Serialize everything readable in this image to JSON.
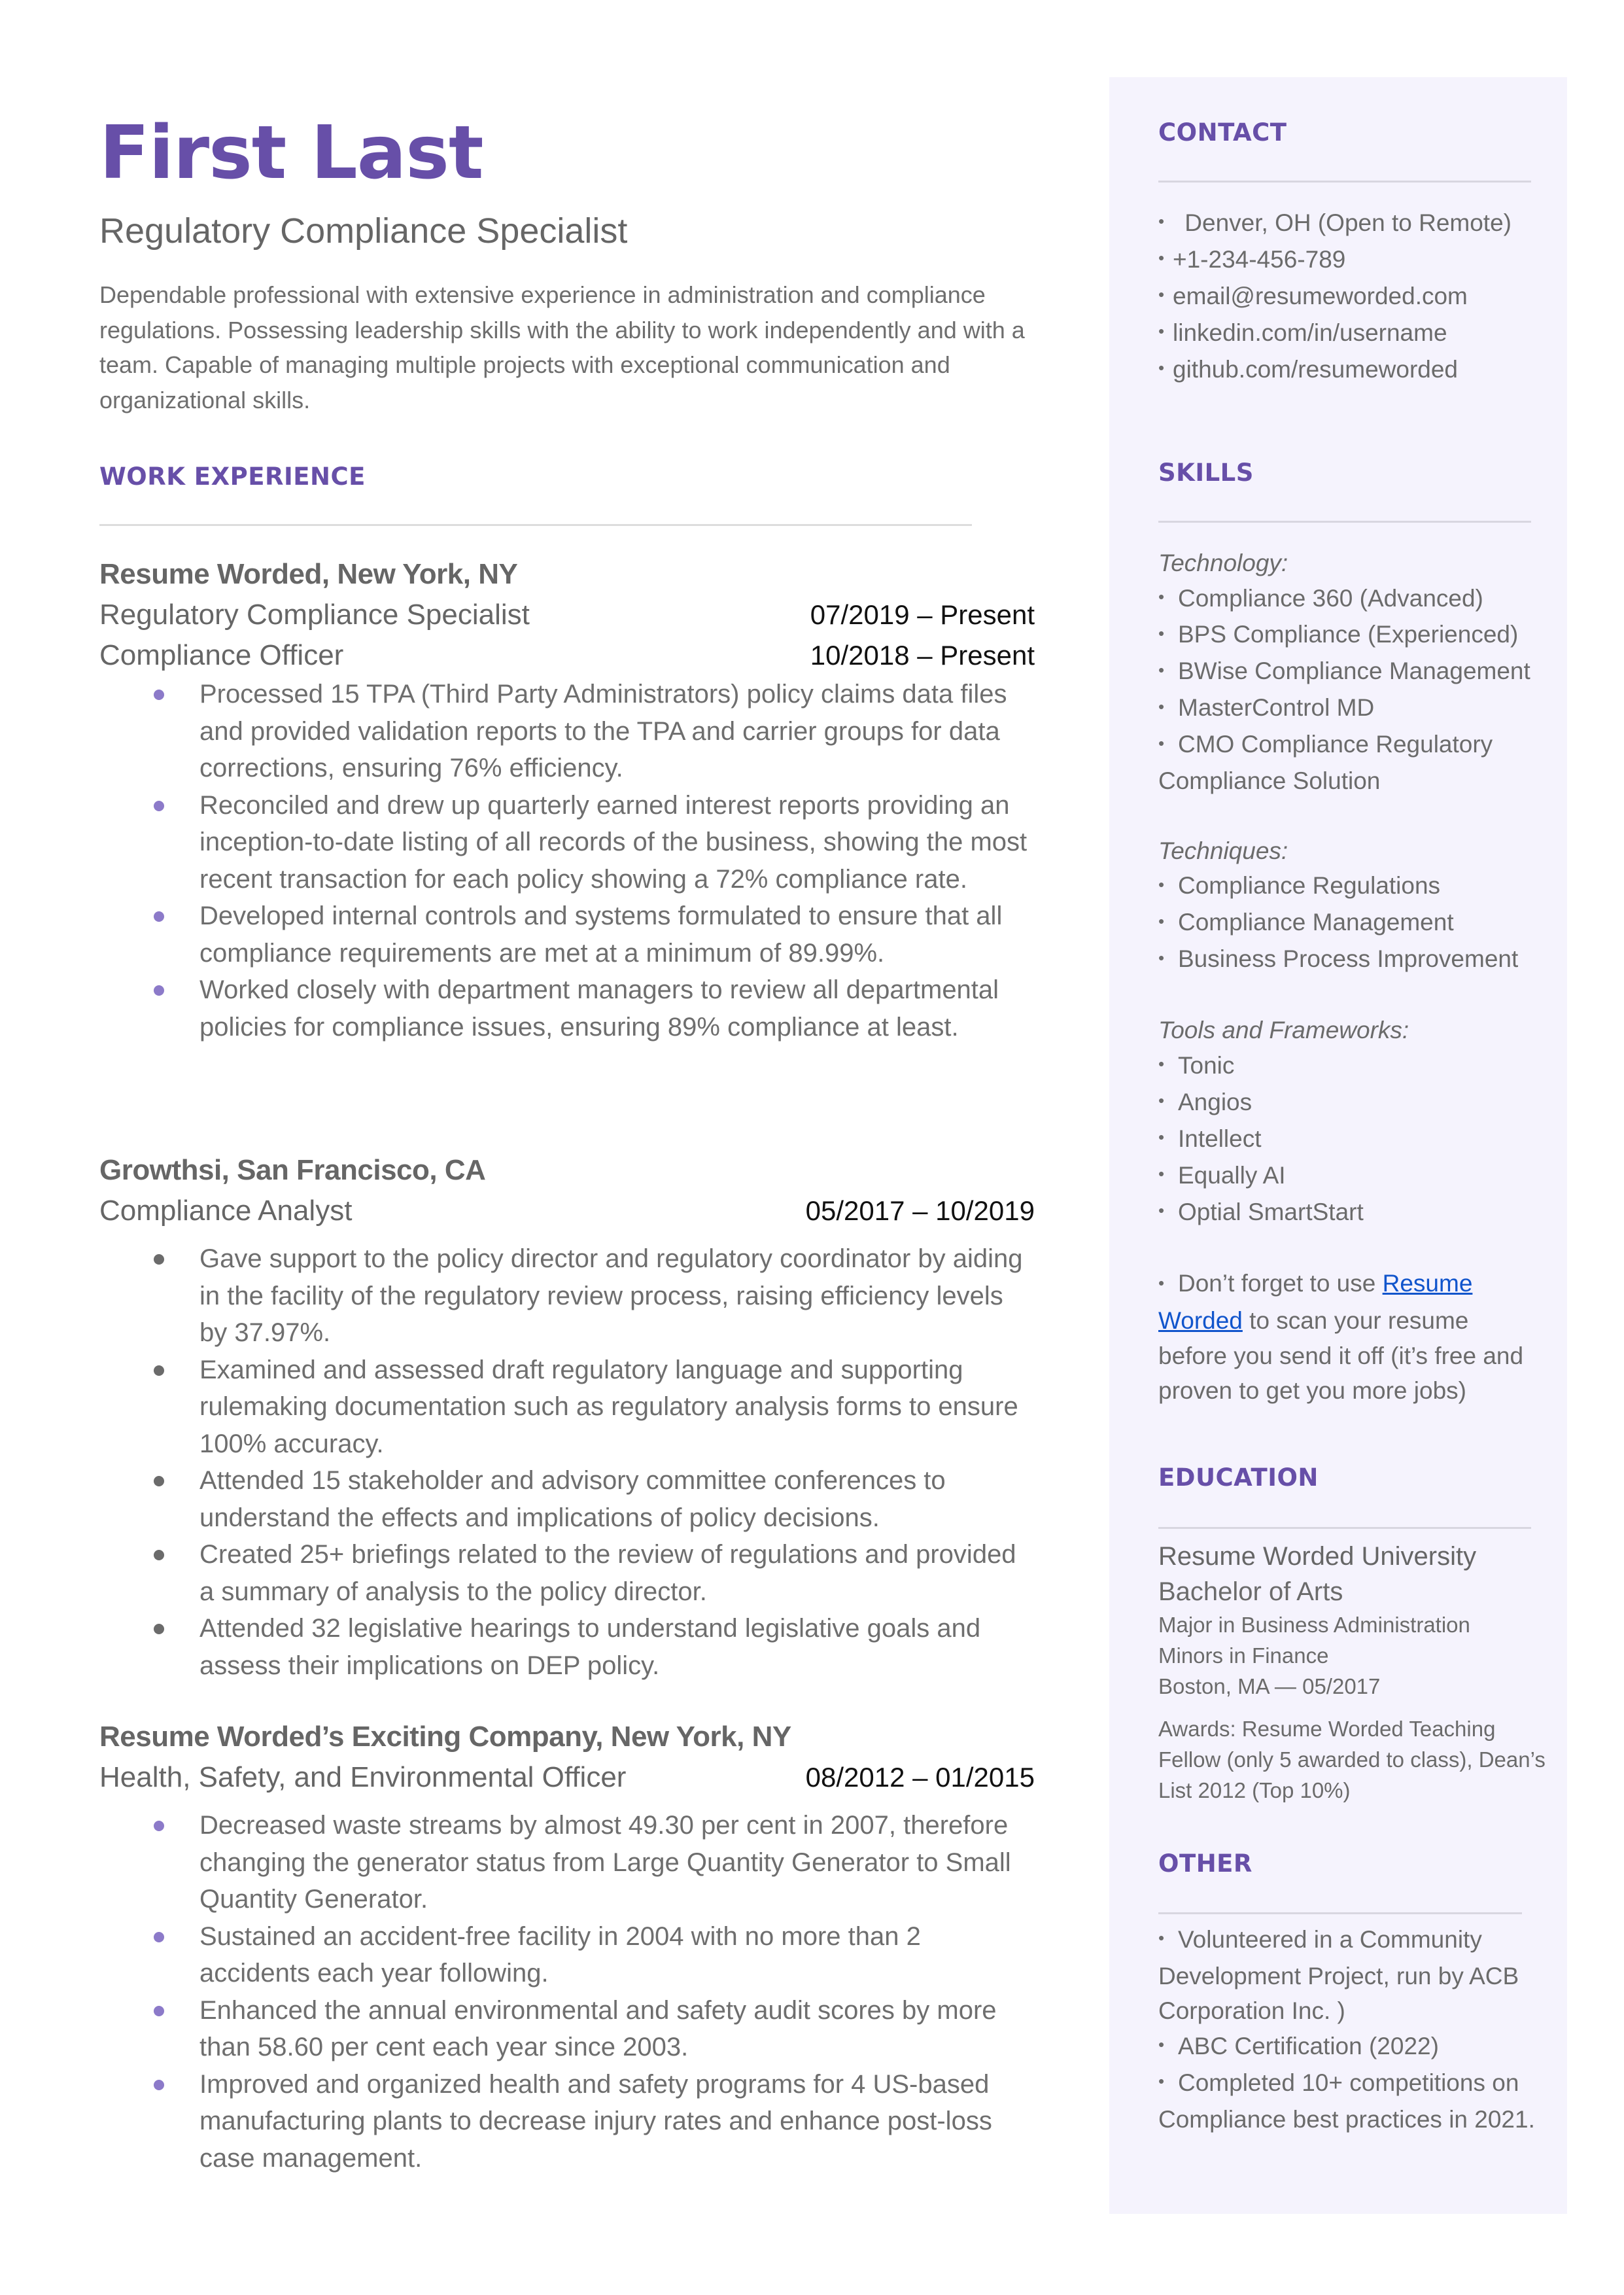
{
  "header": {
    "name": "First Last",
    "title": "Regulatory Compliance Specialist",
    "summary": "Dependable professional with extensive experience in administration and compliance regulations. Possessing leadership skills with the ability to work independently and with a team. Capable of managing multiple projects with exceptional communication and organizational skills."
  },
  "colors": {
    "accent": "#674fa8",
    "bullet_accent": "#8c7ac9",
    "sidebar_bg": "#f5f3fd",
    "text": "#6b6b6b",
    "link": "#1155cc"
  },
  "work": {
    "heading": "WORK EXPERIENCE",
    "jobs": [
      {
        "company": "Resume Worded, New York, NY",
        "roles": [
          {
            "title": "Regulatory Compliance Specialist",
            "dates": "07/2019 – Present"
          },
          {
            "title": "Compliance Officer",
            "dates": "10/2018 – Present"
          }
        ],
        "bullets": [
          "Processed 15 TPA (Third Party Administrators) policy claims data files and provided validation reports to the TPA and carrier groups for data corrections, ensuring 76% efficiency.",
          "Reconciled and drew up quarterly earned interest reports providing an inception-to-date listing of all records of the business, showing the most recent transaction for each policy showing a 72% compliance rate.",
          "Developed internal controls and systems formulated to ensure that all compliance requirements are met at a minimum of 89.99%.",
          "Worked closely with department managers to review all departmental policies for compliance issues, ensuring 89% compliance at least."
        ]
      },
      {
        "company": "Growthsi, San Francisco, CA",
        "roles": [
          {
            "title": "Compliance Analyst",
            "dates": "05/2017 – 10/2019"
          }
        ],
        "bullets": [
          "Gave support to the policy director and regulatory coordinator by aiding in the facility of the regulatory review process, raising efficiency levels by 37.97%.",
          "Examined and assessed draft regulatory language and supporting rulemaking documentation such as regulatory analysis forms to ensure 100% accuracy.",
          "Attended 15 stakeholder and advisory committee conferences to understand the effects and implications of policy decisions.",
          "Created 25+ briefings related to the review of regulations and provided a summary of analysis to the policy director.",
          "Attended 32 legislative hearings to understand legislative goals and assess their implications on DEP policy."
        ]
      },
      {
        "company": "Resume Worded’s Exciting Company, New York, NY",
        "roles": [
          {
            "title": "Health, Safety, and Environmental Officer",
            "dates": "08/2012 – 01/2015"
          }
        ],
        "bullets": [
          "Decreased waste streams by almost 49.30 per cent in 2007, therefore changing the generator status from Large Quantity Generator to Small Quantity Generator.",
          "Sustained an accident-free facility in 2004 with no more than 2 accidents each year following.",
          "Enhanced the annual environmental and safety audit scores by more than 58.60 per cent each year since 2003.",
          "Improved and organized health and safety programs for 4 US-based manufacturing plants to decrease injury rates and enhance post-loss case management."
        ]
      }
    ]
  },
  "contact": {
    "heading": "CONTACT",
    "items": [
      " Denver, OH (Open to Remote)",
      "+1-234-456-789",
      "email@resumeworded.com",
      "linkedin.com/in/username",
      "github.com/resumeworded"
    ]
  },
  "skills": {
    "heading": "SKILLS",
    "technology_label": "Technology:",
    "technology": [
      "Compliance 360 (Advanced)",
      "BPS Compliance (Experienced)",
      "BWise Compliance Management",
      "MasterControl MD",
      "CMO Compliance Regulatory Compliance Solution"
    ],
    "techniques_label": "Techniques:",
    "techniques": [
      "Compliance Regulations",
      "Compliance Management",
      "Business Process Improvement"
    ],
    "tools_label": "Tools and Frameworks:",
    "tools": [
      "Tonic",
      "Angios",
      "Intellect",
      "Equally AI",
      "Optial SmartStart"
    ],
    "tip_before": "Don’t forget to use ",
    "tip_link": "Resume Worded",
    "tip_after": " to scan your resume before you send it off (it’s free and proven to get you more jobs)"
  },
  "education": {
    "heading": "EDUCATION",
    "school": "Resume Worded University",
    "degree": "Bachelor of Arts",
    "major": "Major in Business Administration",
    "minor": "Minors in Finance",
    "location_date": "Boston, MA — 05/2017",
    "awards": "Awards: Resume Worded Teaching Fellow (only 5 awarded to class), Dean’s List 2012 (Top 10%)"
  },
  "other": {
    "heading": "OTHER",
    "items": [
      "Volunteered in a Community Development Project, run by ACB Corporation Inc. )",
      "ABC Certification (2022)",
      "Completed 10+ competitions on Compliance best practices  in 2021."
    ]
  }
}
